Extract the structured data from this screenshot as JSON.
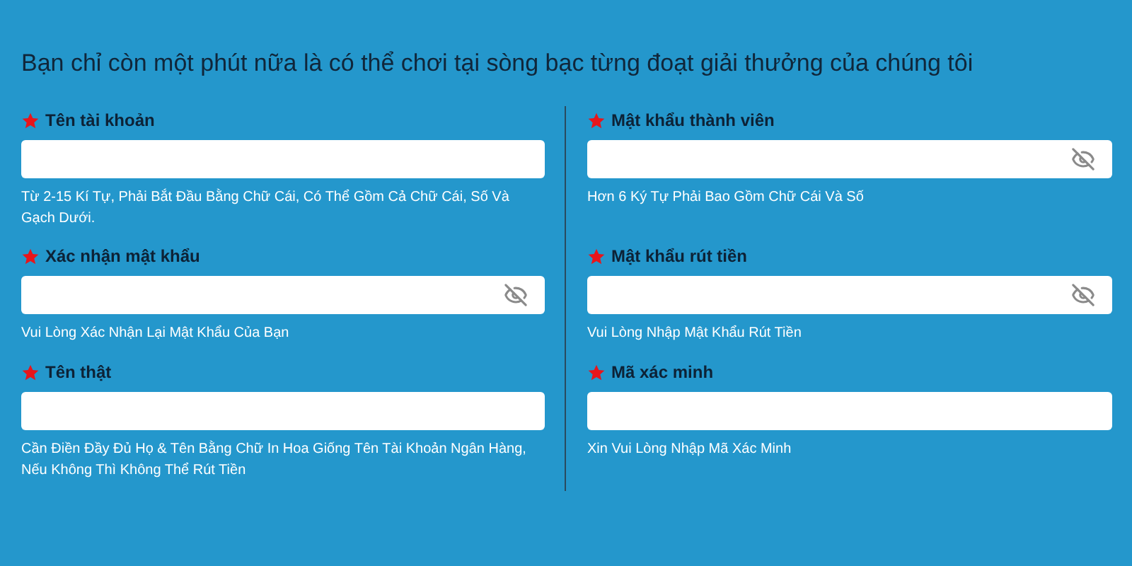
{
  "heading": "Bạn chỉ còn một phút nữa là có thể chơi tại sòng bạc từng đoạt giải thưởng của chúng tôi",
  "columns": [
    {
      "fields": [
        {
          "label": "Tên tài khoản",
          "required": true,
          "kind": "text",
          "hint": "Từ 2-15 Kí Tự, Phải Bắt Đầu Bằng Chữ Cái, Có Thể Gồm Cả Chữ Cái, Số Và Gạch Dưới."
        },
        {
          "label": "Xác nhận mật khẩu",
          "required": true,
          "kind": "password",
          "hint": "Vui Lòng Xác Nhận Lại Mật Khẩu Của Bạn"
        },
        {
          "label": "Tên thật",
          "required": true,
          "kind": "text",
          "hint": "Cần Điền Đầy Đủ Họ & Tên Bằng Chữ In Hoa Giống Tên Tài Khoản Ngân Hàng, Nếu Không Thì Không Thể Rút Tiền"
        }
      ]
    },
    {
      "fields": [
        {
          "label": "Mật khẩu thành viên",
          "required": true,
          "kind": "password",
          "hint": "Hơn 6 Ký Tự Phải Bao Gồm Chữ Cái Và Số"
        },
        {
          "label": "Mật khẩu rút tiền",
          "required": true,
          "kind": "password",
          "hint": "Vui Lòng Nhập Mật Khẩu Rút Tiền"
        },
        {
          "label": "Mã xác minh",
          "required": true,
          "kind": "text",
          "hint": "Xin Vui Lòng Nhập Mã Xác Minh"
        }
      ]
    }
  ]
}
